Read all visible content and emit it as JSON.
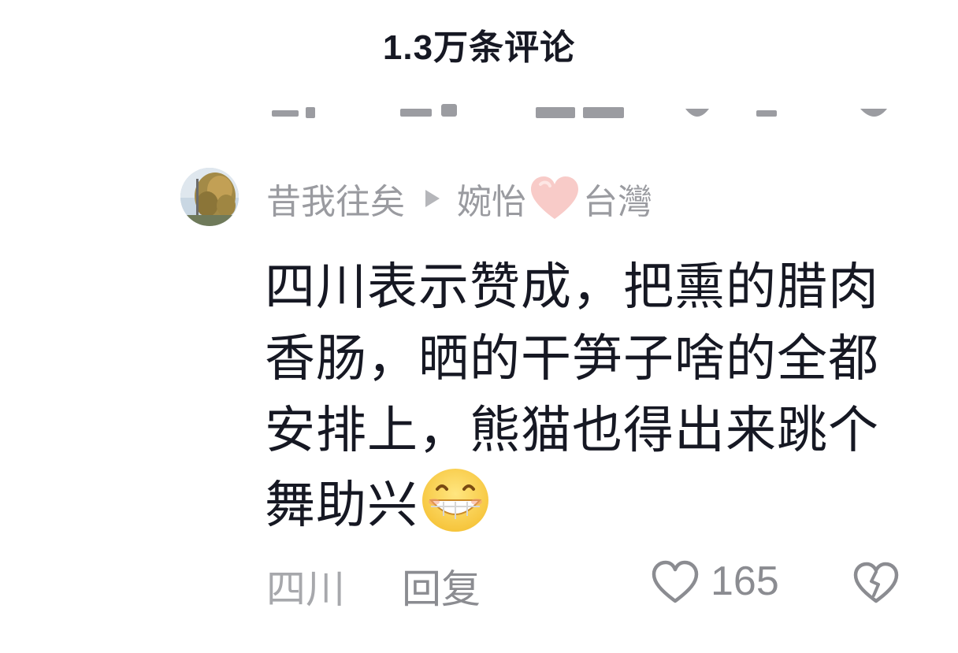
{
  "header": {
    "comment_count_title": "1.3万条评论"
  },
  "comment": {
    "author": "昔我往矣",
    "reply_to": "婉怡",
    "reply_to_suffix": "台灣",
    "text": "四川表示赞成，把熏的腊肉香肠，晒的干笋子啥的全都安排上，熊猫也得出来跳个舞助兴",
    "location": "四川",
    "reply_label": "回复",
    "like_count": "165",
    "heart_emoji_icon": "pink-heart-icon",
    "trailing_emoji_icon": "grin-emoji-icon"
  },
  "colors": {
    "text_primary": "#161823",
    "text_secondary": "#9a9ba0",
    "icon_gray": "#8b8c91",
    "pink_heart": "#f7c9c6"
  }
}
